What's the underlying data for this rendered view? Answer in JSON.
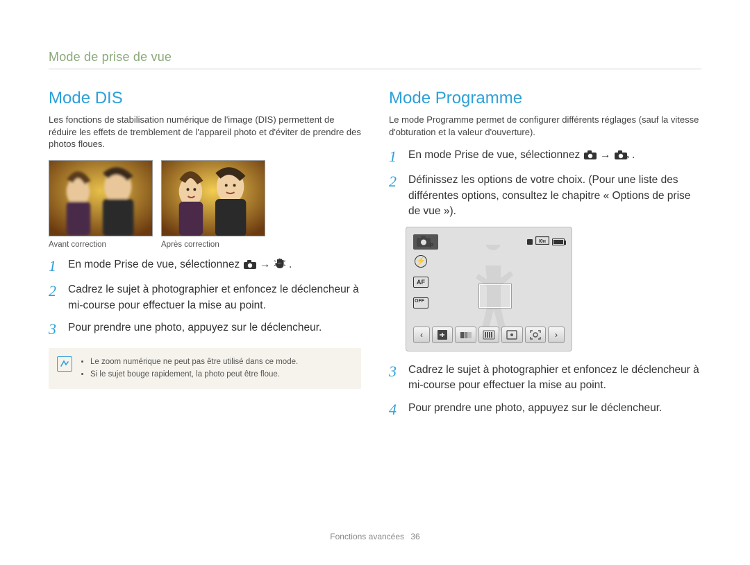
{
  "chapter_title": "Mode de prise de vue",
  "left": {
    "title": "Mode DIS",
    "intro": "Les fonctions de stabilisation numérique de l'image (DIS) permettent de réduire les effets de tremblement de l'appareil photo et d'éviter de prendre des photos floues.",
    "caption_before": "Avant correction",
    "caption_after": "Après correction",
    "step1_prefix": "En mode Prise de vue, sélectionnez ",
    "step1_arrow": " → ",
    "step1_suffix": ".",
    "step2": "Cadrez le sujet à photographier et enfoncez le déclencheur à mi-course pour effectuer la mise au point.",
    "step3": "Pour prendre une photo, appuyez sur le déclencheur.",
    "note1": "Le zoom numérique ne peut pas être utilisé dans ce mode.",
    "note2": "Si le sujet bouge rapidement, la photo peut être floue."
  },
  "right": {
    "title": "Mode Programme",
    "intro": "Le mode Programme permet de configurer différents réglages (sauf la vitesse d'obturation et la valeur d'ouverture).",
    "step1_prefix": "En mode Prise de vue, sélectionnez ",
    "step1_arrow": " → ",
    "step1_suffix": ".",
    "step2": "Définissez les options de votre choix. (Pour une liste des différentes options, consultez le chapitre « Options de prise de vue »).",
    "step3": "Cadrez le sujet à photographier et enfoncez le déclencheur à mi-course pour effectuer la mise au point.",
    "step4": "Pour prendre une photo, appuyez sur le déclencheur.",
    "screen": {
      "mode_badge": "Op",
      "af_label": "AF",
      "off_label": "OFF"
    }
  },
  "nums": {
    "n1": "1",
    "n2": "2",
    "n3": "3",
    "n4": "4"
  },
  "footer": {
    "section": "Fonctions avancées",
    "page": "36"
  }
}
